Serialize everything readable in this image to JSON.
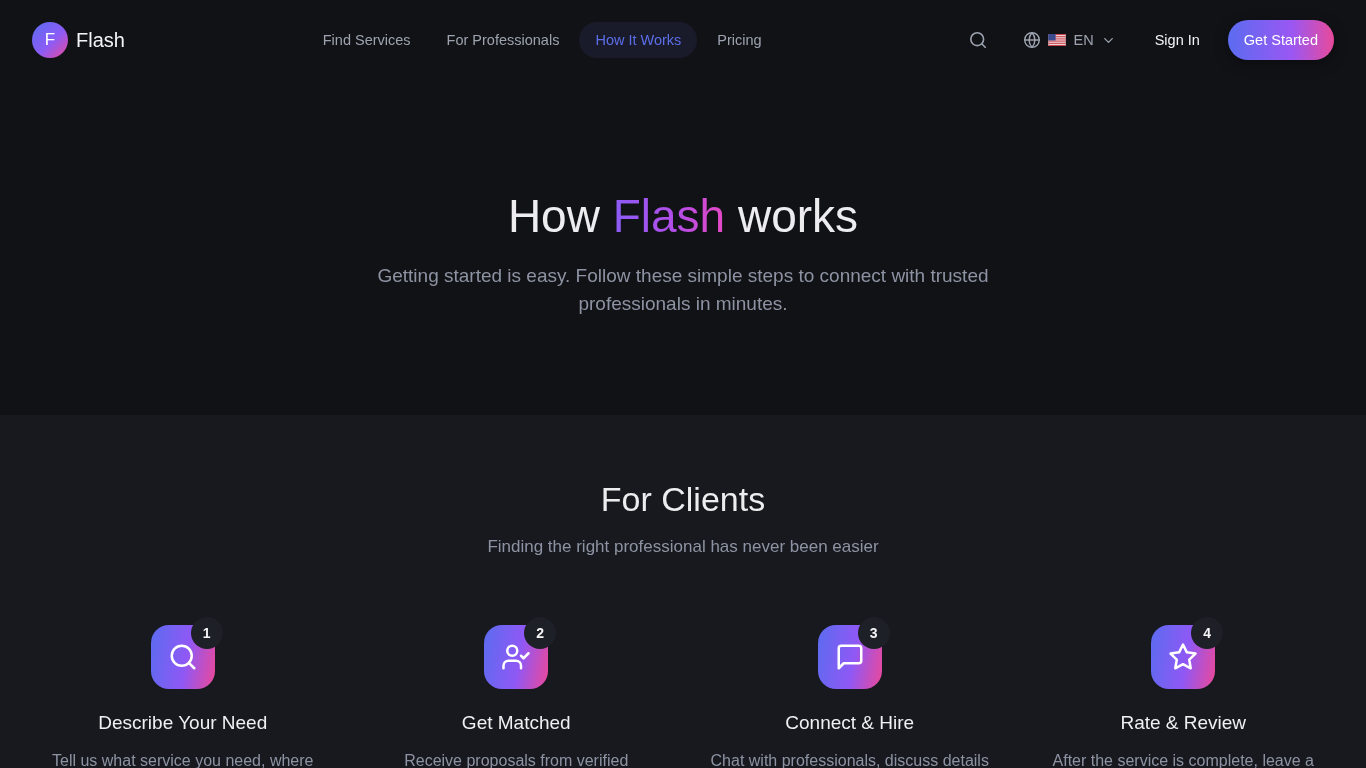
{
  "header": {
    "logo": {
      "letter": "F",
      "name": "Flash"
    },
    "nav": [
      {
        "label": "Find Services",
        "selected": false
      },
      {
        "label": "For Professionals",
        "selected": false
      },
      {
        "label": "How It Works",
        "selected": true
      },
      {
        "label": "Pricing",
        "selected": false
      }
    ],
    "language": {
      "code": "EN"
    },
    "sign_in": "Sign In",
    "cta": "Get Started"
  },
  "hero": {
    "title": [
      {
        "text": "How",
        "highlight": false
      },
      {
        "text": "Flash",
        "highlight": true
      },
      {
        "text": "works",
        "highlight": false
      }
    ],
    "subtitle": "Getting started is easy. Follow these simple steps to connect with trusted professionals in minutes."
  },
  "clients": {
    "title": "For Clients",
    "subtitle": "Finding the right professional has never been easier",
    "steps": [
      {
        "number": "1",
        "title": "Describe Your Need",
        "description": "Tell us what service you need, where"
      },
      {
        "number": "2",
        "title": "Get Matched",
        "description": "Receive proposals from verified"
      },
      {
        "number": "3",
        "title": "Connect & Hire",
        "description": "Chat with professionals, discuss details"
      },
      {
        "number": "4",
        "title": "Rate & Review",
        "description": "After the service is complete, leave a"
      }
    ]
  }
}
